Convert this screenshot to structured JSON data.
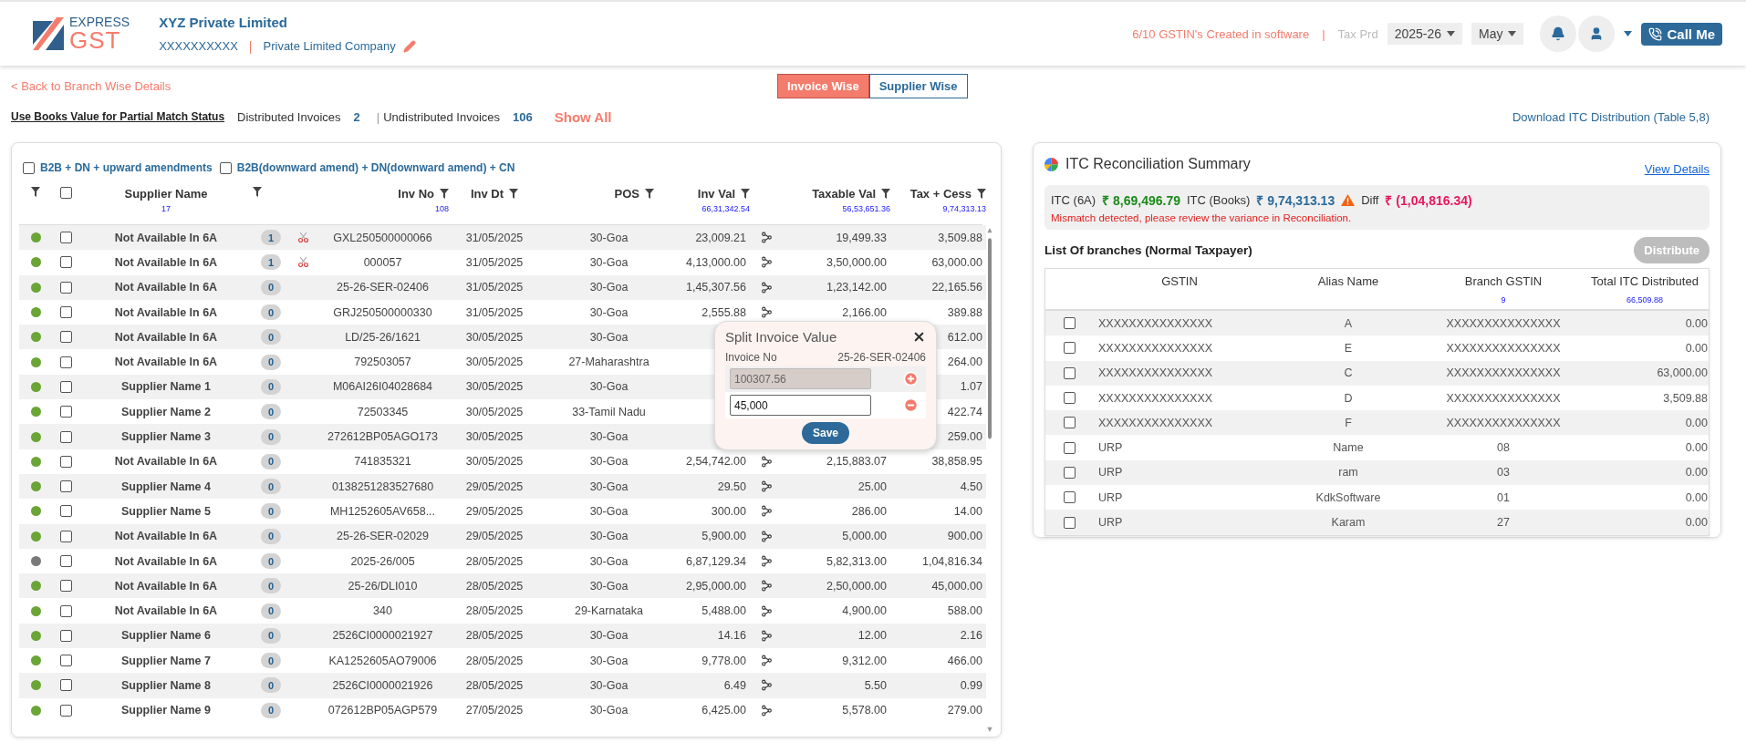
{
  "header": {
    "logo": {
      "top": "EXPRESS",
      "bottom": "GST"
    },
    "company": "XYZ Private Limited",
    "pan": "XXXXXXXXXX",
    "separator": "|",
    "company_type": "Private Limited Company",
    "gstin_note": "6/10 GSTIN's Created in software",
    "note_separator": "|",
    "tax_period_label": "Tax Prd",
    "year": "2025-26",
    "month": "May",
    "call_button": "Call Me"
  },
  "back_link": "< Back to Branch Wise Details",
  "view_toggle": [
    {
      "label": "Invoice Wise",
      "selected": true
    },
    {
      "label": "Supplier Wise",
      "selected": false
    }
  ],
  "summary_bar": {
    "books_value_link": "Use Books Value for Partial Match Status",
    "distributed_label": "Distributed Invoices",
    "distributed_count": "2",
    "separator": "|",
    "undistributed_label": "Undistributed Invoices",
    "undistributed_count": "106",
    "show_all": "Show All",
    "download_link": "Download ITC Distribution (Table 5,8)"
  },
  "invoice_panel": {
    "filters": [
      {
        "label": "B2B + DN + upward amendments",
        "checked": false
      },
      {
        "label": "B2B(downward amend) + DN(downward amend) + CN",
        "checked": false
      }
    ],
    "header_checked": false,
    "columns": {
      "supplier": "Supplier Name",
      "inv_no": "Inv No",
      "inv_dt": "Inv Dt",
      "pos": "POS",
      "inv_val": "Inv Val",
      "taxable_val": "Taxable Val",
      "tax_cess": "Tax + Cess"
    },
    "totals": {
      "supplier": "17",
      "inv_no": "108",
      "inv_val": "66,31,342.54",
      "taxable_val": "56,53,651.36",
      "tax_cess": "9,74,313.13"
    },
    "rows": [
      {
        "color": "#6aa536",
        "checked": false,
        "supplier": "Not Available In 6A",
        "count": "1",
        "split": true,
        "inv_no": "GXL250500000066",
        "inv_dt": "31/05/2025",
        "pos": "30-Goa",
        "inv_val": "23,009.21",
        "taxable_val": "19,499.33",
        "tax_cess": "3,509.88"
      },
      {
        "color": "#6aa536",
        "checked": false,
        "supplier": "Not Available In 6A",
        "count": "1",
        "split": true,
        "inv_no": "000057",
        "inv_dt": "31/05/2025",
        "pos": "30-Goa",
        "inv_val": "4,13,000.00",
        "taxable_val": "3,50,000.00",
        "tax_cess": "63,000.00"
      },
      {
        "color": "#6aa536",
        "checked": false,
        "supplier": "Not Available In 6A",
        "count": "0",
        "split": false,
        "inv_no": "25-26-SER-02406",
        "inv_dt": "31/05/2025",
        "pos": "30-Goa",
        "inv_val": "1,45,307.56",
        "taxable_val": "1,23,142.00",
        "tax_cess": "22,165.56"
      },
      {
        "color": "#6aa536",
        "checked": false,
        "supplier": "Not Available In 6A",
        "count": "0",
        "split": false,
        "inv_no": "GRJ250500000330",
        "inv_dt": "31/05/2025",
        "pos": "30-Goa",
        "inv_val": "2,555.88",
        "taxable_val": "2,166.00",
        "tax_cess": "389.88"
      },
      {
        "color": "#6aa536",
        "checked": false,
        "supplier": "Not Available In 6A",
        "count": "0",
        "split": false,
        "inv_no": "LD/25-26/1621",
        "inv_dt": "30/05/2025",
        "pos": "30-Goa",
        "tax_cess": "612.00"
      },
      {
        "color": "#6aa536",
        "checked": false,
        "supplier": "Not Available In 6A",
        "count": "0",
        "split": false,
        "inv_no": "792503057",
        "inv_dt": "30/05/2025",
        "pos": "27-Maharashtra",
        "tax_cess": "264.00"
      },
      {
        "color": "#6aa536",
        "checked": false,
        "supplier": "Supplier Name 1",
        "count": "0",
        "split": false,
        "inv_no": "M06AI26I04028684",
        "inv_dt": "30/05/2025",
        "pos": "30-Goa",
        "tax_cess": "1.07"
      },
      {
        "color": "#6aa536",
        "checked": false,
        "supplier": "Supplier Name 2",
        "count": "0",
        "split": false,
        "inv_no": "72503345",
        "inv_dt": "30/05/2025",
        "pos": "33-Tamil Nadu",
        "tax_cess": "422.74"
      },
      {
        "color": "#6aa536",
        "checked": false,
        "supplier": "Supplier Name 3",
        "count": "0",
        "split": false,
        "inv_no": "272612BP05AGO173",
        "inv_dt": "30/05/2025",
        "pos": "30-Goa",
        "tax_cess": "259.00"
      },
      {
        "color": "#6aa536",
        "checked": false,
        "supplier": "Not Available In 6A",
        "count": "0",
        "split": false,
        "inv_no": "741835321",
        "inv_dt": "30/05/2025",
        "pos": "30-Goa",
        "inv_val": "2,54,742.00",
        "taxable_val": "2,15,883.07",
        "tax_cess": "38,858.95"
      },
      {
        "color": "#6aa536",
        "checked": false,
        "supplier": "Supplier Name 4",
        "count": "0",
        "split": false,
        "inv_no": "0138251283527680",
        "inv_dt": "29/05/2025",
        "pos": "30-Goa",
        "inv_val": "29.50",
        "taxable_val": "25.00",
        "tax_cess": "4.50"
      },
      {
        "color": "#6aa536",
        "checked": false,
        "supplier": "Supplier Name 5",
        "count": "0",
        "split": false,
        "inv_no": "MH1252605AV658...",
        "inv_dt": "29/05/2025",
        "pos": "30-Goa",
        "inv_val": "300.00",
        "taxable_val": "286.00",
        "tax_cess": "14.00"
      },
      {
        "color": "#6aa536",
        "checked": false,
        "supplier": "Not Available In 6A",
        "count": "0",
        "split": false,
        "inv_no": "25-26-SER-02029",
        "inv_dt": "29/05/2025",
        "pos": "30-Goa",
        "inv_val": "5,900.00",
        "taxable_val": "5,000.00",
        "tax_cess": "900.00"
      },
      {
        "color": "#7a7a7a",
        "checked": false,
        "supplier": "Not Available In 6A",
        "count": "0",
        "split": false,
        "inv_no": "2025-26/005",
        "inv_dt": "28/05/2025",
        "pos": "30-Goa",
        "inv_val": "6,87,129.34",
        "taxable_val": "5,82,313.00",
        "tax_cess": "1,04,816.34"
      },
      {
        "color": "#6aa536",
        "checked": false,
        "supplier": "Not Available In 6A",
        "count": "0",
        "split": false,
        "inv_no": "25-26/DLI010",
        "inv_dt": "28/05/2025",
        "pos": "30-Goa",
        "inv_val": "2,95,000.00",
        "taxable_val": "2,50,000.00",
        "tax_cess": "45,000.00"
      },
      {
        "color": "#6aa536",
        "checked": false,
        "supplier": "Not Available In 6A",
        "count": "0",
        "split": false,
        "inv_no": "340",
        "inv_dt": "28/05/2025",
        "pos": "29-Karnataka",
        "inv_val": "5,488.00",
        "taxable_val": "4,900.00",
        "tax_cess": "588.00"
      },
      {
        "color": "#6aa536",
        "checked": false,
        "supplier": "Supplier Name 6",
        "count": "0",
        "split": false,
        "inv_no": "2526CI0000021927",
        "inv_dt": "28/05/2025",
        "pos": "30-Goa",
        "inv_val": "14.16",
        "taxable_val": "12.00",
        "tax_cess": "2.16"
      },
      {
        "color": "#6aa536",
        "checked": false,
        "supplier": "Supplier Name 7",
        "count": "0",
        "split": false,
        "inv_no": "KA1252605AO79006",
        "inv_dt": "28/05/2025",
        "pos": "30-Goa",
        "inv_val": "9,778.00",
        "taxable_val": "9,312.00",
        "tax_cess": "466.00"
      },
      {
        "color": "#6aa536",
        "checked": false,
        "supplier": "Supplier Name 8",
        "count": "0",
        "split": false,
        "inv_no": "2526CI0000021926",
        "inv_dt": "28/05/2025",
        "pos": "30-Goa",
        "inv_val": "6.49",
        "taxable_val": "5.50",
        "tax_cess": "0.99"
      },
      {
        "color": "#6aa536",
        "checked": false,
        "supplier": "Supplier Name 9",
        "count": "0",
        "split": false,
        "inv_no": "072612BP05AGP579",
        "inv_dt": "27/05/2025",
        "pos": "30-Goa",
        "inv_val": "6,425.00",
        "taxable_val": "5,578.00",
        "tax_cess": "279.00"
      }
    ]
  },
  "split_popup": {
    "title": "Split Invoice Value",
    "invoice_label": "Invoice No",
    "invoice_no": "25-26-SER-02406",
    "parts": [
      {
        "kind": "add",
        "value": "100307.56",
        "disabled": true
      },
      {
        "kind": "remove",
        "value": "45,000",
        "disabled": false
      }
    ],
    "save": "Save"
  },
  "itc_panel": {
    "title": "ITC Reconciliation Summary",
    "view_details": "View Details",
    "itc_6a_label": "ITC (6A)",
    "itc_6a": "₹ 8,69,496.79",
    "itc_books_label": "ITC (Books)",
    "itc_books": "₹ 9,74,313.13",
    "diff_label": "Diff",
    "diff": "₹ (1,04,816.34)",
    "message": "Mismatch detected, please review the variance in Reconciliation.",
    "list_title": "List Of branches (Normal Taxpayer)",
    "distribute": {
      "label": "Distribute",
      "disabled": true
    },
    "columns": [
      "GSTIN",
      "Alias Name",
      "Branch GSTIN",
      "Total ITC Distributed"
    ],
    "totals": {
      "branch_gstin": "9",
      "total_itc": "66,509.88"
    },
    "branches": [
      {
        "checked": false,
        "gstin": "XXXXXXXXXXXXXXX",
        "alias": "A",
        "branch_gstin": "XXXXXXXXXXXXXXX",
        "total": "0.00"
      },
      {
        "checked": false,
        "gstin": "XXXXXXXXXXXXXXX",
        "alias": "E",
        "branch_gstin": "XXXXXXXXXXXXXXX",
        "total": "0.00"
      },
      {
        "checked": false,
        "gstin": "XXXXXXXXXXXXXXX",
        "alias": "C",
        "branch_gstin": "XXXXXXXXXXXXXXX",
        "total": "63,000.00"
      },
      {
        "checked": false,
        "gstin": "XXXXXXXXXXXXXXX",
        "alias": "D",
        "branch_gstin": "XXXXXXXXXXXXXXX",
        "total": "3,509.88"
      },
      {
        "checked": false,
        "gstin": "XXXXXXXXXXXXXXX",
        "alias": "F",
        "branch_gstin": "XXXXXXXXXXXXXXX",
        "total": "0.00"
      },
      {
        "checked": false,
        "gstin": "URP",
        "alias": "Name",
        "branch_gstin": "08",
        "total": "0.00"
      },
      {
        "checked": false,
        "gstin": "URP",
        "alias": "ram",
        "branch_gstin": "03",
        "total": "0.00"
      },
      {
        "checked": false,
        "gstin": "URP",
        "alias": "KdkSoftware",
        "branch_gstin": "01",
        "total": "0.00"
      },
      {
        "checked": false,
        "gstin": "URP",
        "alias": "Karam",
        "branch_gstin": "27",
        "total": "0.00"
      }
    ]
  }
}
